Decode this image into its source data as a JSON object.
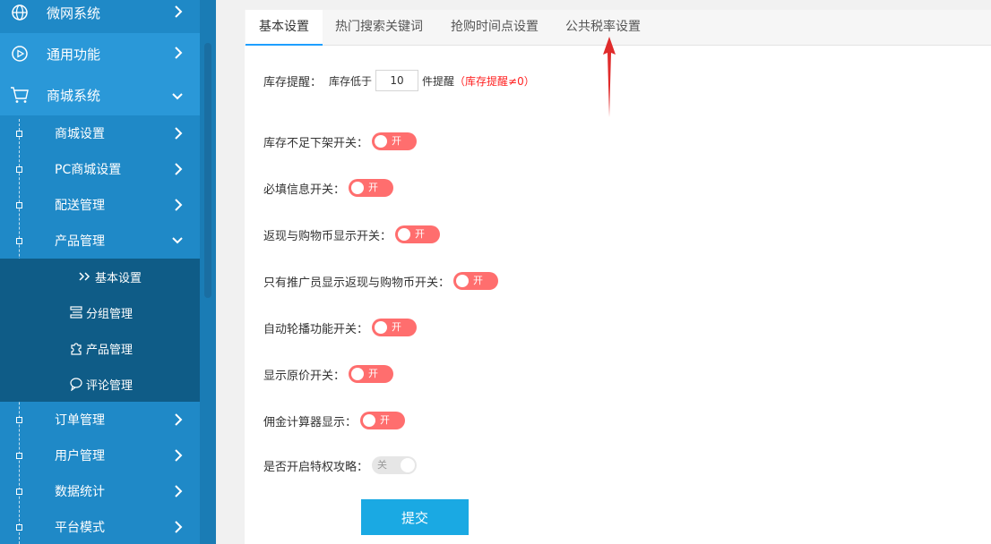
{
  "sidebar": {
    "top_items": [
      {
        "label": "微网系统",
        "icon": "globe-icon"
      },
      {
        "label": "通用功能",
        "icon": "play-circle-icon"
      },
      {
        "label": "商城系统",
        "icon": "cart-icon"
      }
    ],
    "sub_items": [
      {
        "label": "商城设置"
      },
      {
        "label": "PC商城设置"
      },
      {
        "label": "配送管理"
      },
      {
        "label": "产品管理"
      },
      {
        "label": "订单管理"
      },
      {
        "label": "用户管理"
      },
      {
        "label": "数据统计"
      },
      {
        "label": "平台模式"
      }
    ],
    "deep_items": [
      {
        "label": "基本设置",
        "icon": "double-chevron-icon"
      },
      {
        "label": "分组管理",
        "icon": "list-icon"
      },
      {
        "label": "产品管理",
        "icon": "puzzle-icon"
      },
      {
        "label": "评论管理",
        "icon": "comment-icon"
      }
    ]
  },
  "tabs": [
    {
      "label": "基本设置",
      "active": true
    },
    {
      "label": "热门搜索关键词",
      "active": false
    },
    {
      "label": "抢购时间点设置",
      "active": false
    },
    {
      "label": "公共税率设置",
      "active": false
    }
  ],
  "stock": {
    "label": "库存提醒：",
    "prefix": "库存低于",
    "value": "10",
    "suffix": "件提醒",
    "note": "（库存提醒≠0）"
  },
  "switches": [
    {
      "label": "库存不足下架开关：",
      "state": "开"
    },
    {
      "label": "必填信息开关：",
      "state": "开"
    },
    {
      "label": "返现与购物币显示开关：",
      "state": "开"
    },
    {
      "label": "只有推广员显示返现与购物币开关：",
      "state": "开"
    },
    {
      "label": "自动轮播功能开关：",
      "state": "开"
    },
    {
      "label": "显示原价开关：",
      "state": "开"
    },
    {
      "label": "佣金计算器显示：",
      "state": "开"
    },
    {
      "label": "是否开启特权攻略：",
      "state": "关"
    }
  ],
  "submit_label": "提交",
  "colors": {
    "sidebar": "#1f89c7",
    "sidebar_deep": "#0f5c87",
    "switch_on": "#ff6e6e",
    "switch_off": "#e6e6e6",
    "submit": "#1aa9e3",
    "tab_active": "#1e9fff",
    "note_red": "#ff2222"
  }
}
